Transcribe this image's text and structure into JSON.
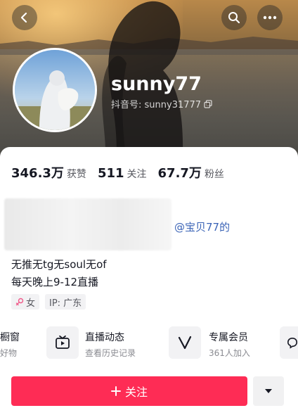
{
  "profile": {
    "username": "sunny77",
    "douyin_id_label": "抖音号: sunny31777"
  },
  "stats": [
    {
      "value": "346.3万",
      "label": "获赞"
    },
    {
      "value": "511",
      "label": "关注"
    },
    {
      "value": "67.7万",
      "label": "粉丝"
    }
  ],
  "bio": {
    "mention": "@宝贝77的",
    "line1": "无推无tg无soul无of",
    "line2": "每天晚上9-12直播"
  },
  "tags": {
    "gender": "女",
    "ip": "IP: 广东"
  },
  "entries": [
    {
      "title": "橱窗",
      "subtitle": "好物"
    },
    {
      "title": "直播动态",
      "subtitle": "查看历史记录"
    },
    {
      "title": "专属会员",
      "subtitle": "361人加入"
    }
  ],
  "actions": {
    "follow_label": "关注"
  },
  "icons": {
    "back": "back-arrow-icon",
    "search": "search-icon",
    "more": "more-icon",
    "copy": "copy-icon",
    "gender": "female-icon",
    "live": "tv-icon",
    "member": "v-icon",
    "chat": "chat-icon",
    "dropdown": "triangle-down-icon"
  },
  "colors": {
    "accent": "#fe2c55",
    "mention": "#3a63b6"
  }
}
